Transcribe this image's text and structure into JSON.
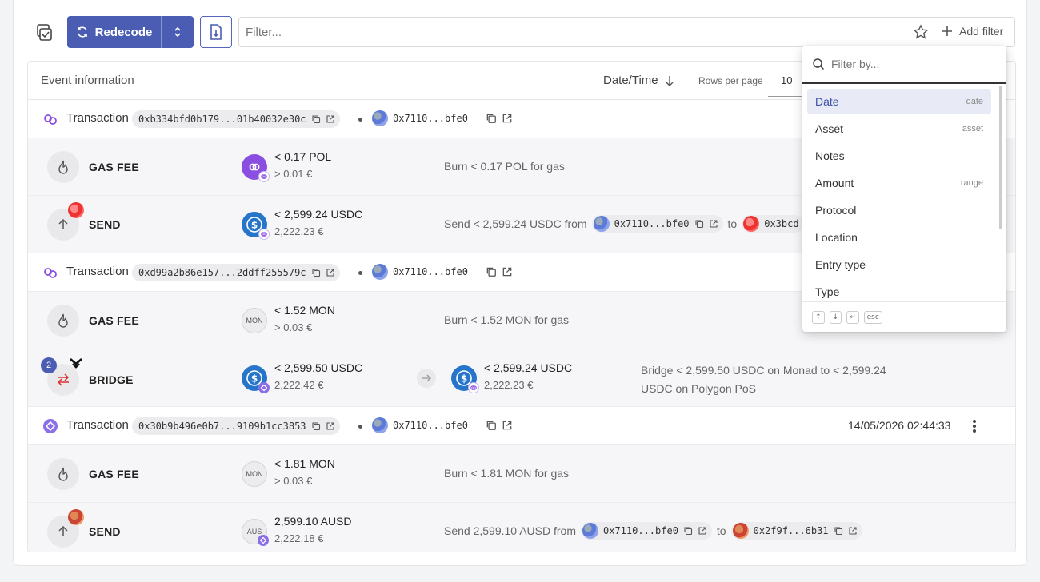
{
  "toolbar": {
    "redecode_label": "Redecode",
    "filter_placeholder": "Filter...",
    "add_filter_label": "Add filter",
    "accent_color": "#4a5db3"
  },
  "table": {
    "headers": {
      "event_information": "Event information",
      "datetime": "Date/Time",
      "rows_per_page_label": "Rows per page",
      "rows_per_page_value": "10"
    },
    "groups": [
      {
        "label": "Transaction",
        "hash": "0xb334bfd0b179...01b40032e30c",
        "from": "0x7110...bfe0",
        "events": [
          {
            "type": "GAS FEE",
            "amount": "< 0.17 POL",
            "fiat": "> 0.01 €",
            "asset_icon": "polygon-icon",
            "description": "Burn < 0.17 POL for gas"
          },
          {
            "type": "SEND",
            "amount": "< 2,599.24 USDC",
            "fiat": "2,222.23 €",
            "asset_icon": "usdc-icon",
            "description_prefix": "Send < 2,599.24 USDC from",
            "from": "0x7110...bfe0",
            "to_word": "to",
            "to": "0x3bcd"
          }
        ]
      },
      {
        "label": "Transaction",
        "hash": "0xd99a2b86e157...2ddff255579c",
        "from": "0x7110...bfe0",
        "events": [
          {
            "type": "GAS FEE",
            "amount": "< 1.52 MON",
            "fiat": "> 0.03 €",
            "asset_text": "MON",
            "description": "Burn < 1.52 MON for gas"
          },
          {
            "type": "BRIDGE",
            "badge": "2",
            "amount": "< 2,599.50 USDC",
            "fiat": "2,222.42 €",
            "amount2": "< 2,599.24 USDC",
            "fiat2": "2,222.23 €",
            "description_line1": "Bridge < 2,599.50 USDC on Monad to < 2,599.24",
            "description_line2": "USDC on Polygon PoS"
          }
        ]
      },
      {
        "label": "Transaction",
        "hash": "0x30b9b496e0b7...9109b1cc3853",
        "from": "0x7110...bfe0",
        "datetime": "14/05/2026 02:44:33",
        "events": [
          {
            "type": "GAS FEE",
            "amount": "< 1.81 MON",
            "fiat": "> 0.03 €",
            "asset_text": "MON",
            "description": "Burn < 1.81 MON for gas"
          },
          {
            "type": "SEND",
            "amount": "2,599.10 AUSD",
            "fiat": "2,222.18 €",
            "asset_text": "AUS",
            "description_prefix": "Send 2,599.10 AUSD from",
            "from": "0x7110...bfe0",
            "to_word": "to",
            "to": "0x2f9f...6b31"
          }
        ]
      }
    ]
  },
  "filter_dropdown": {
    "placeholder": "Filter by...",
    "items": [
      {
        "label": "Date",
        "hint": "date"
      },
      {
        "label": "Asset",
        "hint": "asset"
      },
      {
        "label": "Notes",
        "hint": ""
      },
      {
        "label": "Amount",
        "hint": "range"
      },
      {
        "label": "Protocol",
        "hint": ""
      },
      {
        "label": "Location",
        "hint": ""
      },
      {
        "label": "Entry type",
        "hint": ""
      },
      {
        "label": "Type",
        "hint": ""
      }
    ],
    "keys": [
      "↑",
      "↓",
      "↵",
      "esc"
    ]
  }
}
